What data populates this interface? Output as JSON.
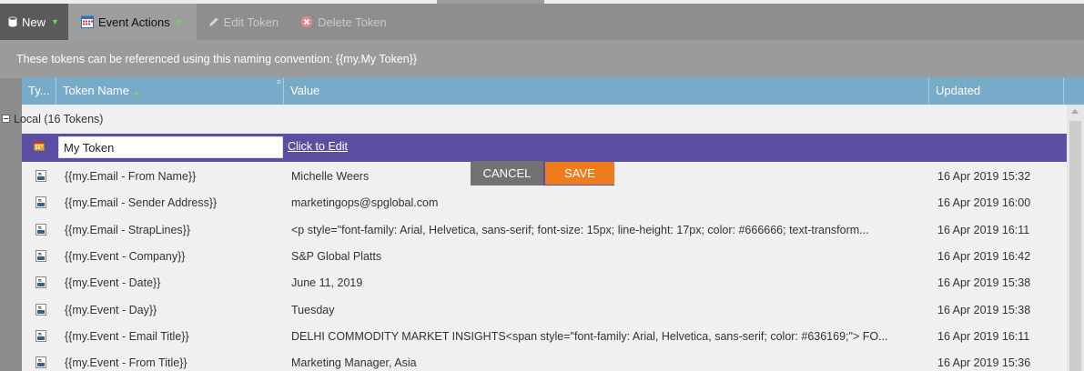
{
  "toolbar": {
    "new_label": "New",
    "event_actions_label": "Event Actions",
    "edit_token_label": "Edit Token",
    "delete_token_label": "Delete Token"
  },
  "info_text": "These tokens can be referenced using this naming convention: {{my.My Token}}",
  "grid": {
    "headers": {
      "type": "Ty...",
      "token_name": "Token Name",
      "value": "Value",
      "updated": "Updated"
    },
    "group_label": "Local (16 Tokens)",
    "edit_row": {
      "token_name_value": "My Token",
      "value_link": "Click to Edit",
      "cancel_label": "CANCEL",
      "save_label": "SAVE"
    },
    "rows": [
      {
        "name": "{{my.Email - From Name}}",
        "value": "Michelle Weers",
        "updated": "16 Apr 2019 15:32"
      },
      {
        "name": "{{my.Email - Sender Address}}",
        "value": "marketingops@spglobal.com",
        "updated": "16 Apr 2019 16:00"
      },
      {
        "name": "{{my.Email - StrapLines}}",
        "value": "<p style=\"font-family: Arial, Helvetica, sans-serif; font-size: 15px; line-height: 17px; color: #666666; text-transform...",
        "updated": "16 Apr 2019 16:11"
      },
      {
        "name": "{{my.Event - Company}}",
        "value": "S&P Global Platts",
        "updated": "16 Apr 2019 16:42"
      },
      {
        "name": "{{my.Event - Date}}",
        "value": "June 11, 2019",
        "updated": "16 Apr 2019 15:38"
      },
      {
        "name": "{{my.Event - Day}}",
        "value": "Tuesday",
        "updated": "16 Apr 2019 15:38"
      },
      {
        "name": "{{my.Event - Email Title}}",
        "value": "DELHI COMMODITY MARKET INSIGHTS<span style=\"font-family: Arial, Helvetica, sans-serif; color: #636169;\"> FO...",
        "updated": "16 Apr 2019 16:11"
      },
      {
        "name": "{{my.Event - From Title}}",
        "value": "Marketing Manager, Asia",
        "updated": "16 Apr 2019 15:36"
      }
    ]
  },
  "colors": {
    "header_bg": "#78aac9",
    "selected_row": "#5a4fa2",
    "save_button": "#f07d1d",
    "cancel_button": "#727272"
  },
  "icons": {
    "new": "database-icon",
    "event_actions": "calendar-icon",
    "edit_token": "pencil-icon",
    "delete_token": "delete-circle-icon",
    "row_type": "text-token-icon"
  }
}
